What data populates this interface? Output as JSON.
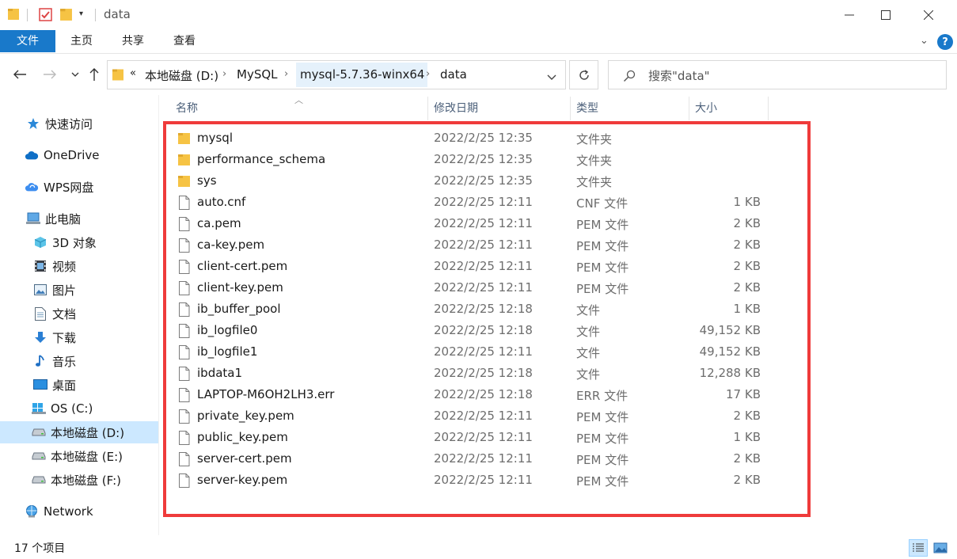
{
  "window": {
    "title": "data",
    "controls": {
      "minimize": "—",
      "maximize": "☐",
      "close": "✕"
    }
  },
  "ribbon": {
    "tabs": [
      {
        "label": "文件",
        "active": true
      },
      {
        "label": "主页"
      },
      {
        "label": "共享"
      },
      {
        "label": "查看"
      }
    ],
    "help_label": "?"
  },
  "address": {
    "overflow": "«",
    "crumbs": [
      "本地磁盘 (D:)",
      "MySQL",
      "mysql-5.7.36-winx64",
      "data"
    ],
    "search_placeholder": "搜索\"data\""
  },
  "nav": {
    "items": [
      {
        "label": "快速访问",
        "icon": "star-icon"
      },
      {
        "label": "OneDrive",
        "icon": "cloud-icon"
      },
      {
        "label": "WPS网盘",
        "icon": "wps-cloud-icon"
      },
      {
        "label": "此电脑",
        "icon": "computer-icon"
      },
      {
        "label": "3D 对象",
        "icon": "cube-icon"
      },
      {
        "label": "视频",
        "icon": "video-icon"
      },
      {
        "label": "图片",
        "icon": "picture-icon"
      },
      {
        "label": "文档",
        "icon": "document-icon"
      },
      {
        "label": "下载",
        "icon": "download-icon"
      },
      {
        "label": "音乐",
        "icon": "music-icon"
      },
      {
        "label": "桌面",
        "icon": "desktop-icon"
      },
      {
        "label": "OS (C:)",
        "icon": "os-drive-icon"
      },
      {
        "label": "本地磁盘 (D:)",
        "icon": "drive-icon",
        "selected": true
      },
      {
        "label": "本地磁盘 (E:)",
        "icon": "drive-icon"
      },
      {
        "label": "本地磁盘 (F:)",
        "icon": "drive-icon"
      },
      {
        "label": "Network",
        "icon": "network-icon"
      }
    ]
  },
  "columns": {
    "name": "名称",
    "date": "修改日期",
    "type": "类型",
    "size": "大小"
  },
  "files": [
    {
      "name": "mysql",
      "date": "2022/2/25 12:35",
      "type": "文件夹",
      "size": "",
      "kind": "folder"
    },
    {
      "name": "performance_schema",
      "date": "2022/2/25 12:35",
      "type": "文件夹",
      "size": "",
      "kind": "folder"
    },
    {
      "name": "sys",
      "date": "2022/2/25 12:35",
      "type": "文件夹",
      "size": "",
      "kind": "folder"
    },
    {
      "name": "auto.cnf",
      "date": "2022/2/25 12:11",
      "type": "CNF 文件",
      "size": "1 KB",
      "kind": "file"
    },
    {
      "name": "ca.pem",
      "date": "2022/2/25 12:11",
      "type": "PEM 文件",
      "size": "2 KB",
      "kind": "file"
    },
    {
      "name": "ca-key.pem",
      "date": "2022/2/25 12:11",
      "type": "PEM 文件",
      "size": "2 KB",
      "kind": "file"
    },
    {
      "name": "client-cert.pem",
      "date": "2022/2/25 12:11",
      "type": "PEM 文件",
      "size": "2 KB",
      "kind": "file"
    },
    {
      "name": "client-key.pem",
      "date": "2022/2/25 12:11",
      "type": "PEM 文件",
      "size": "2 KB",
      "kind": "file"
    },
    {
      "name": "ib_buffer_pool",
      "date": "2022/2/25 12:18",
      "type": "文件",
      "size": "1 KB",
      "kind": "file"
    },
    {
      "name": "ib_logfile0",
      "date": "2022/2/25 12:18",
      "type": "文件",
      "size": "49,152 KB",
      "kind": "file"
    },
    {
      "name": "ib_logfile1",
      "date": "2022/2/25 12:11",
      "type": "文件",
      "size": "49,152 KB",
      "kind": "file"
    },
    {
      "name": "ibdata1",
      "date": "2022/2/25 12:18",
      "type": "文件",
      "size": "12,288 KB",
      "kind": "file"
    },
    {
      "name": "LAPTOP-M6OH2LH3.err",
      "date": "2022/2/25 12:18",
      "type": "ERR 文件",
      "size": "17 KB",
      "kind": "file"
    },
    {
      "name": "private_key.pem",
      "date": "2022/2/25 12:11",
      "type": "PEM 文件",
      "size": "2 KB",
      "kind": "file"
    },
    {
      "name": "public_key.pem",
      "date": "2022/2/25 12:11",
      "type": "PEM 文件",
      "size": "1 KB",
      "kind": "file"
    },
    {
      "name": "server-cert.pem",
      "date": "2022/2/25 12:11",
      "type": "PEM 文件",
      "size": "2 KB",
      "kind": "file"
    },
    {
      "name": "server-key.pem",
      "date": "2022/2/25 12:11",
      "type": "PEM 文件",
      "size": "2 KB",
      "kind": "file"
    }
  ],
  "status": {
    "item_count": "17 个项目"
  },
  "colors": {
    "accent": "#1979ca",
    "selection": "#cce8ff",
    "highlight_box": "#ef3b3b",
    "folder": "#f6c344"
  }
}
